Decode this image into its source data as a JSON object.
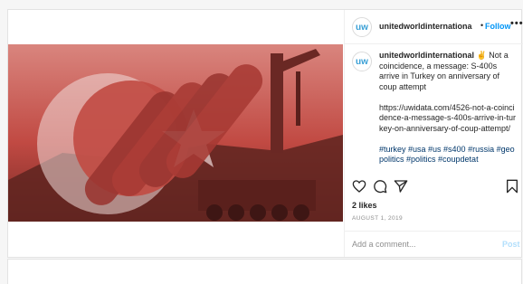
{
  "header": {
    "username": "unitedworldinternationa",
    "separator": "•",
    "follow_label": "Follow",
    "more_label": "•••"
  },
  "caption": {
    "username": "unitedworldinternational",
    "emoji": "✌",
    "text": "Not a coincidence, a message: S-400s arrive in Turkey on anniversary of coup attempt",
    "link": "https://uwidata.com/4526-not-a-coincidence-a-message-s-400s-arrive-in-turkey-on-anniversary-of-coup-attempt/",
    "hashtags": "#turkey #usa #us #s400 #russia #geopolitics #politics #coupdetat"
  },
  "likes": "2 likes",
  "date": "AUGUST 1, 2019",
  "comment": {
    "placeholder": "Add a comment...",
    "post_label": "Post"
  },
  "icons": [
    "avatar-logo",
    "heart-icon",
    "comment-icon",
    "share-icon",
    "bookmark-icon"
  ],
  "colors": {
    "follow_blue": "#0095f6",
    "link_blue": "#00376b",
    "post_disabled": "#b2dffc",
    "flag_red": "#c8322d",
    "logo_blue": "#3aa0d6"
  }
}
